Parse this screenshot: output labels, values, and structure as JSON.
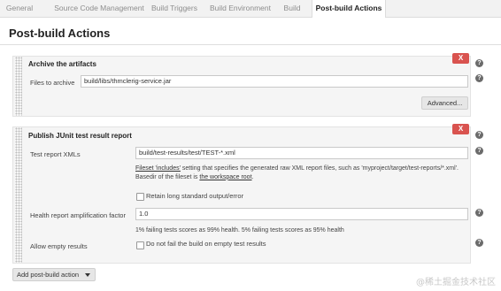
{
  "tabs": [
    {
      "label": "General"
    },
    {
      "label": "Source Code Management"
    },
    {
      "label": "Build Triggers"
    },
    {
      "label": "Build Environment"
    },
    {
      "label": "Build"
    },
    {
      "label": "Post-build Actions"
    }
  ],
  "page_title": "Post-build Actions",
  "archive": {
    "title": "Archive the artifacts",
    "delete_label": "X",
    "files_label": "Files to archive",
    "files_value": "build/libs/thmclerig-service.jar",
    "advanced_label": "Advanced..."
  },
  "junit": {
    "title": "Publish JUnit test result report",
    "delete_label": "X",
    "xml_label": "Test report XMLs",
    "xml_value": "build/test-results/test/TEST-*.xml",
    "desc_link1": "Fileset 'includes'",
    "desc_text1": " setting that specifies the generated raw XML report files, such as 'myproject/target/test-reports/*.xml'. Basedir of the fileset is ",
    "desc_link2": "the workspace root",
    "desc_text2": ".",
    "retain_label": "Retain long standard output/error",
    "health_label": "Health report amplification factor",
    "health_value": "1.0",
    "health_desc": "1% failing tests scores as 99% health. 5% failing tests scores as 95% health",
    "empty_label": "Allow empty results",
    "empty_cb_label": "Do not fail the build on empty test results"
  },
  "help_icon_text": "?",
  "add_button_label": "Add post-build action",
  "watermark": "@稀土掘金技术社区"
}
